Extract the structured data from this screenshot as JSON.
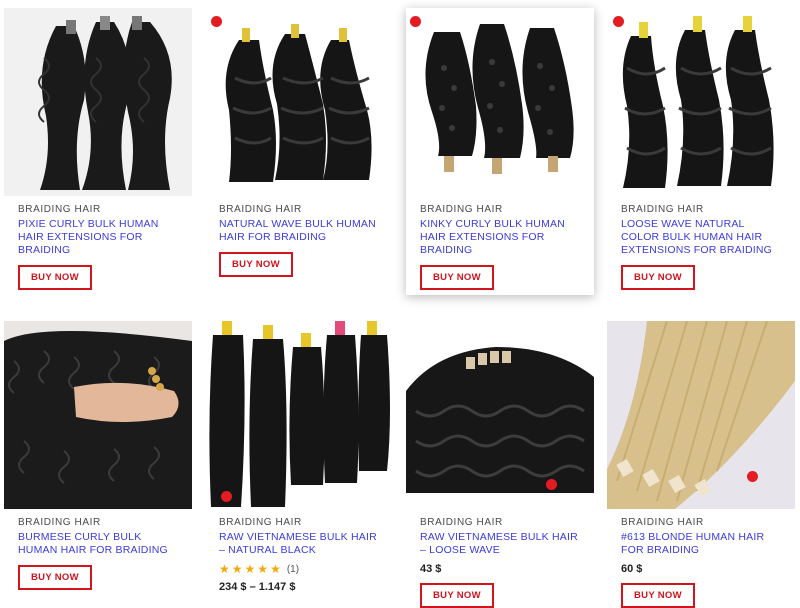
{
  "products": [
    {
      "category": "BRAIDING HAIR",
      "title": "PIXIE CURLY BULK HUMAN HAIR EXTENSIONS FOR BRAIDING",
      "button": "BUY NOW"
    },
    {
      "category": "BRAIDING HAIR",
      "title": "NATURAL WAVE BULK HUMAN HAIR FOR BRAIDING",
      "button": "BUY NOW"
    },
    {
      "category": "BRAIDING HAIR",
      "title": "KINKY CURLY BULK HUMAN HAIR EXTENSIONS FOR BRAIDING",
      "button": "BUY NOW"
    },
    {
      "category": "BRAIDING HAIR",
      "title": "LOOSE WAVE NATURAL COLOR BULK HUMAN HAIR EXTENSIONS FOR BRAIDING",
      "button": "BUY NOW"
    },
    {
      "category": "BRAIDING HAIR",
      "title": "BURMESE CURLY BULK HUMAN HAIR FOR BRAIDING",
      "button": "BUY NOW"
    },
    {
      "category": "BRAIDING HAIR",
      "title": "RAW VIETNAMESE BULK HAIR – NATURAL BLACK",
      "rating_count": "(1)",
      "rating": 5,
      "price": "234 $ – 1.147 $"
    },
    {
      "category": "BRAIDING HAIR",
      "title": "RAW VIETNAMESE BULK HAIR – LOOSE WAVE",
      "price": "43 $",
      "button": "BUY NOW"
    },
    {
      "category": "BRAIDING HAIR",
      "title": "#613 BLONDE HUMAN HAIR FOR BRAIDING",
      "price": "60 $",
      "button": "BUY NOW"
    }
  ],
  "colors": {
    "link": "#3b3bdc",
    "accent": "#d0151d",
    "star": "#f2a90a"
  }
}
